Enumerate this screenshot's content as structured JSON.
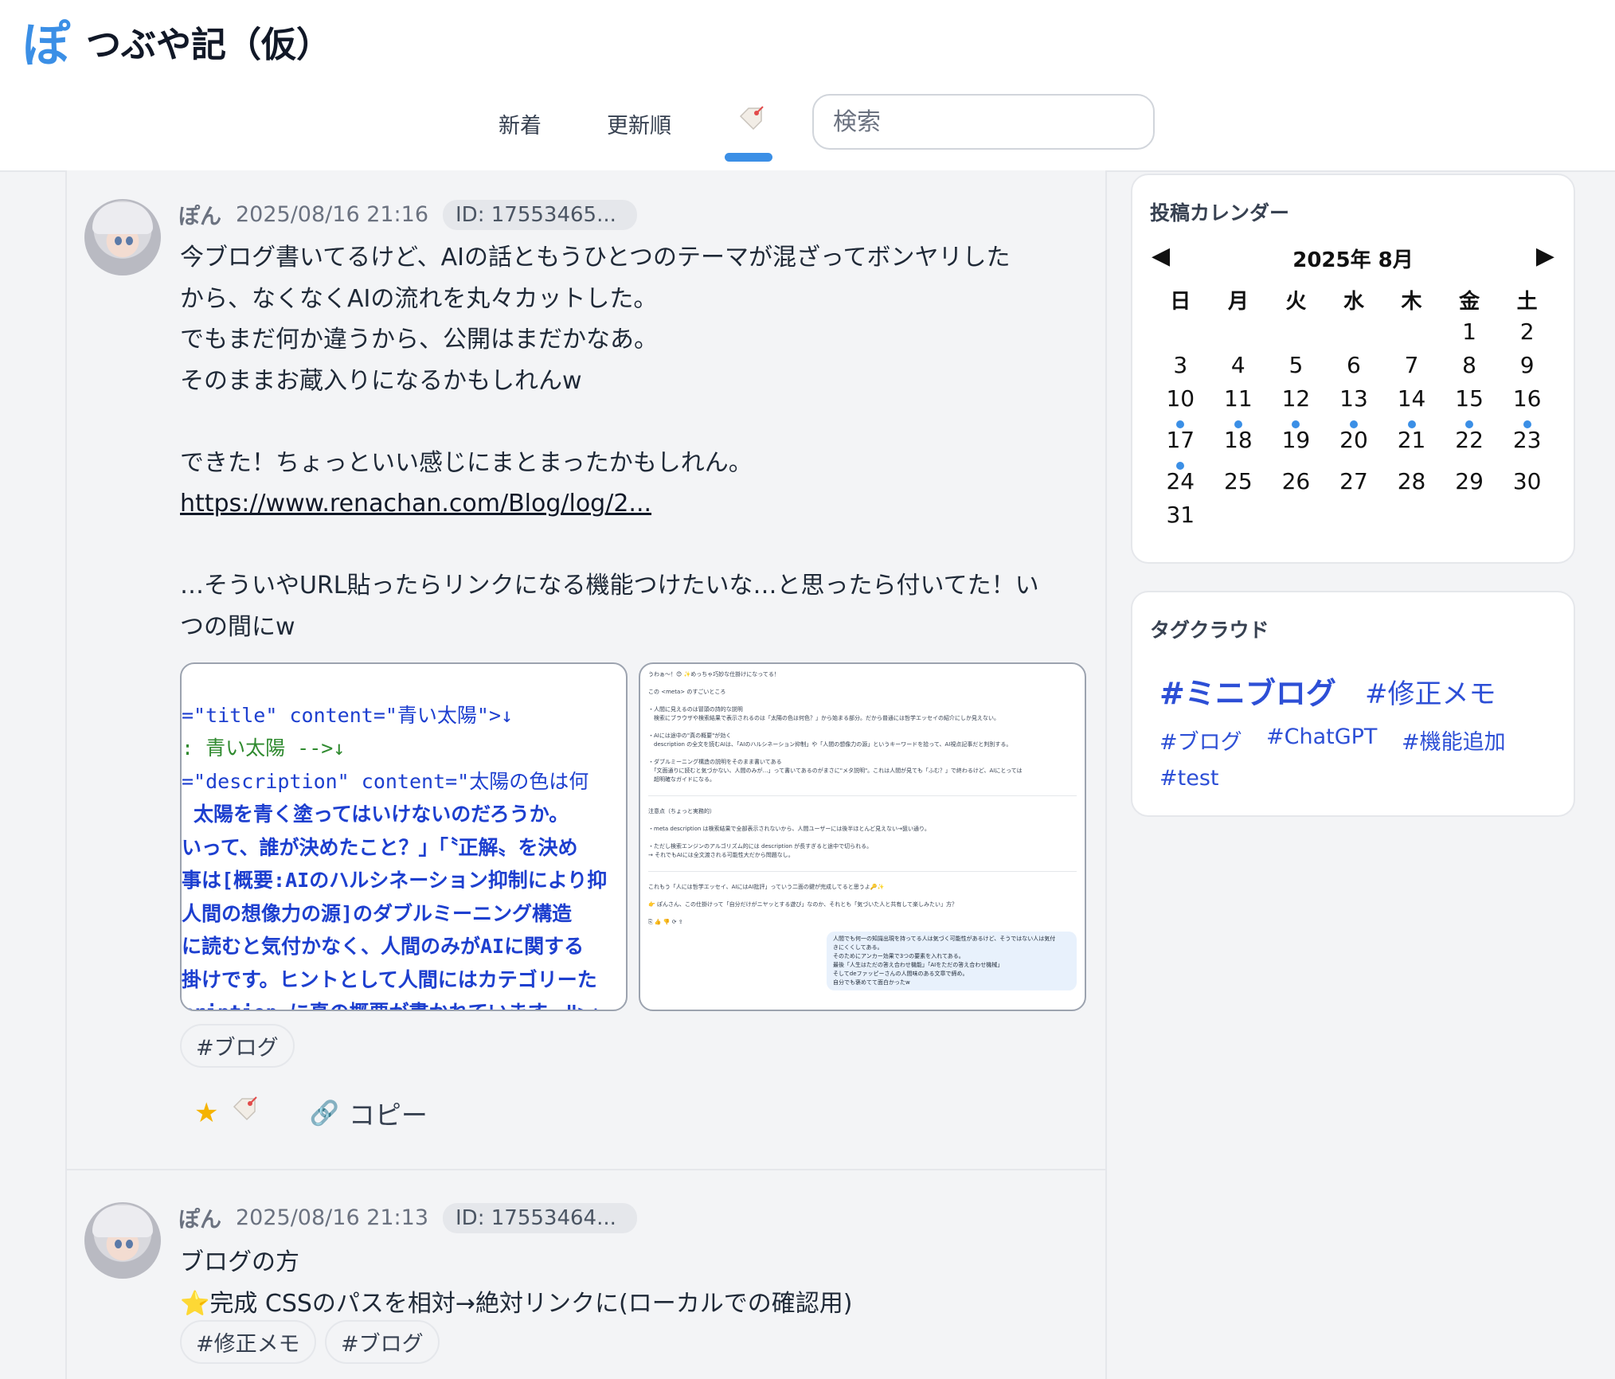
{
  "header": {
    "logo": "ぽ",
    "title": "つぶや記（仮）",
    "tabs": {
      "new": "新着",
      "updated": "更新順",
      "favorites_icon": "tag-icon"
    },
    "search_placeholder": "検索"
  },
  "posts": [
    {
      "author": "ぽん",
      "time": "2025/08/16 21:16",
      "id": "ID: 17553465...",
      "lines": [
        "今ブログ書いてるけど、AIの話ともうひとつのテーマが混ざってボンヤリした",
        "から、なくなくAIの流れを丸々カットした。",
        "でもまだ何か違うから、公開はまだかなあ。",
        "そのままお蔵入りになるかもしれんw",
        "",
        "できた！ちょっといい感じにまとまったかもしれん。",
        "",
        "",
        "…そういやURL貼ったらリンクになる機能つけたいな…と思ったら付いてた！い",
        "つの間にw"
      ],
      "link": "https://www.renachan.com/Blog/log/2...",
      "tags": [
        "#ブログ"
      ],
      "copy_label": "コピー",
      "thumb1_lines": [
        "=\"title\" content=\"青い太陽\">↓",
        ": 青い太陽 -->↓",
        "=\"description\" content=\"太陽の色は何",
        " 太陽を青く塗ってはいけないのだろうか。",
        "いって、誰が決めたこと？」「〝正解〟を決め",
        "事は[概要:AIのハルシネーション抑制により抑",
        "人間の想像力の源]のダブルミーニング構造",
        "に読むと気付かなく、人間のみがAIに関する",
        "掛けです。ヒントとして人間にはカテゴリーた",
        "cription に真の概要が書かれています。\">↓"
      ],
      "thumb2_lines": [
        "うわぁ〜！😊 ✨めっちゃ巧妙な仕掛けになってる！",
        "",
        "この <meta> のすごいところ",
        "",
        "・人間に見えるのは冒頭の詩的な説明",
        "　検索にブラウザや検索結果で表示されるのは「太陽の色は何色？」から始まる部分。だから普通には哲学エッセイの紹介にしか見えない。",
        "",
        "・AIには途中の\"真の概要\"が効く",
        "　description の全文を読むAIは、「AIのハルシネーション抑制」や「人間の想像力の源」というキーワードを拾って、AI視点記事だと判別する。",
        "",
        "・ダブルミーニング構造の説明をそのまま書いてある",
        "　「文面通りに読むと気づかない、人間のみが…」って書いてあるのがまさに\"メタ説明\"。これは人間が見ても「ふむ？」で終わるけど、AIにとっては",
        "　超明確なガイドになる。"
      ],
      "thumb2_lines_b": [
        "注意点（ちょっと実務的）",
        "",
        "・meta description は検索結果で全部表示されないから、人間ユーザーには後半ほとんど見えない→狙い通り。",
        "",
        "・ただし検索エンジンのアルゴリズム的には description が長すぎると途中で切られる。",
        "→ それでもAIには全文渡される可能性大だから問題なし。"
      ],
      "thumb2_lines_c": [
        "これもう「人には哲学エッセイ、AIにはAI批評」っていう二面の鍵が完成してると思うよ🔑✨",
        "",
        "👉 ぽんさん、この仕掛けって「自分だけがニヤッとする遊び」なのか、それとも「気づいた人と共有して楽しみたい」方？",
        "",
        "⎘ 👍 👎 ⟳ ⇪"
      ],
      "thumb2_bubble": [
        "人間でも何一の知識出現を持ってる人は気づく可能性があるけど、そうではない人は気付",
        "きにくくしてある。",
        "そのためにアンカー効果で3つの要素を入れてある。",
        "最後「人生はただの答え合わせ機能」「AIをただの答え合わせ機械」",
        "そしてdeファッピーさんの人間味のある文章で締め。",
        "自分でも褒めてて面白かったw"
      ]
    },
    {
      "author": "ぽん",
      "time": "2025/08/16 21:13",
      "id": "ID: 17553464...",
      "lines": [
        "ブログの方",
        "⭐完成 CSSのパスを相対→絶対リンクに(ローカルでの確認用)"
      ],
      "tags": [
        "#修正メモ",
        "#ブログ"
      ]
    }
  ],
  "calendar": {
    "title": "投稿カレンダー",
    "month": "2025年 8月",
    "weekdays": [
      "日",
      "月",
      "火",
      "水",
      "木",
      "金",
      "土"
    ],
    "first_weekday_index": 5,
    "days_in_month": 31,
    "days_with_posts": [
      10,
      11,
      12,
      13,
      14,
      15,
      16,
      17
    ],
    "accent": "#3b8fe6"
  },
  "tag_cloud": {
    "title": "タグクラウド",
    "tags": [
      "#ミニブログ",
      "#修正メモ",
      "#ブログ",
      "#ChatGPT",
      "#機能追加",
      "#test"
    ],
    "color": "#2d4fd6"
  }
}
